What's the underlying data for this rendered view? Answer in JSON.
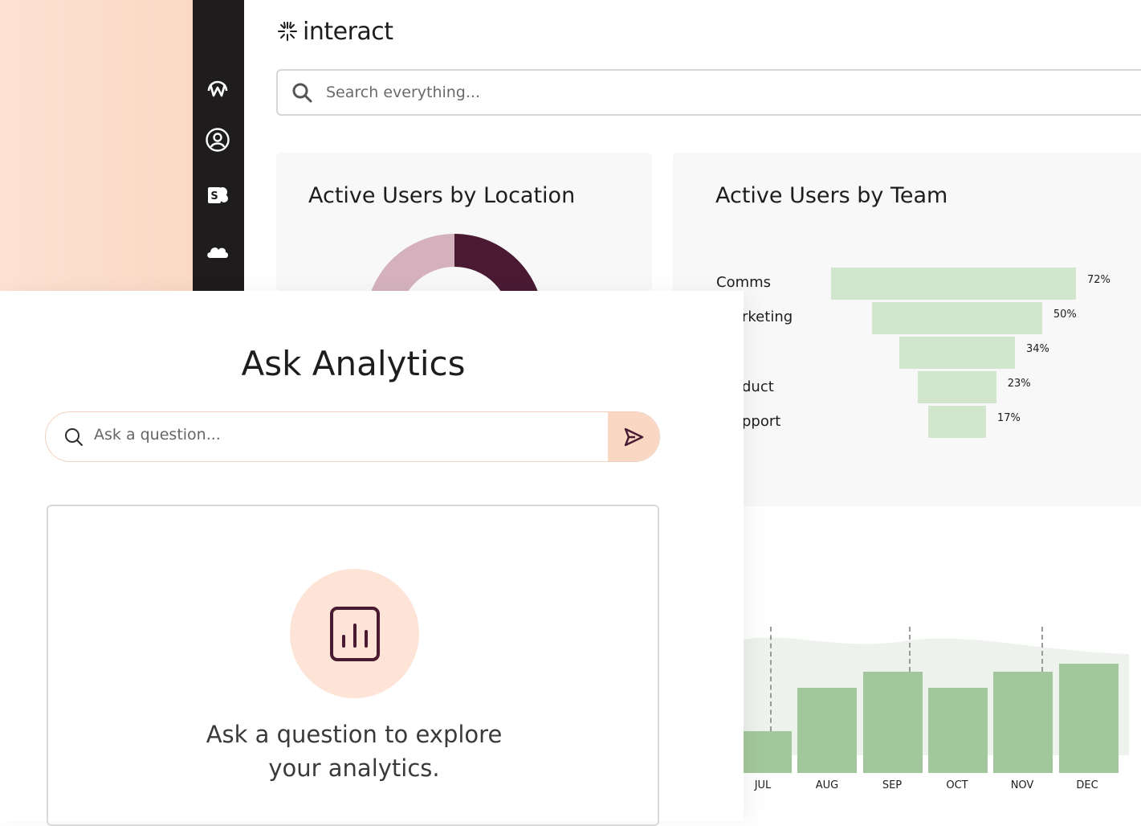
{
  "app": {
    "logo_text": "interact"
  },
  "search": {
    "placeholder": "Search everything..."
  },
  "nav": [
    {
      "icon": "workplace-icon"
    },
    {
      "icon": "user-circle-icon"
    },
    {
      "icon": "sharepoint-icon"
    },
    {
      "icon": "cloud-icon"
    }
  ],
  "location_card": {
    "title": "Active Users by Location"
  },
  "team_card": {
    "title": "Active Users by Team",
    "bars": [
      {
        "label": "Comms",
        "pct": "72%"
      },
      {
        "label": "rketing",
        "pct": "50%"
      },
      {
        "label": "",
        "pct": "34%"
      },
      {
        "label": "duct",
        "pct": "23%"
      },
      {
        "label": "pport",
        "pct": "17%"
      }
    ]
  },
  "chart_data": [
    {
      "type": "pie",
      "title": "Active Users by Location",
      "values": [
        50,
        50
      ],
      "colors": [
        "#4a1a33",
        "#d4b1bd"
      ]
    },
    {
      "type": "bar",
      "title": "Active Users by Team",
      "categories": [
        "Comms",
        "rketing",
        "",
        "duct",
        "pport"
      ],
      "values": [
        72,
        50,
        34,
        23,
        17
      ],
      "color": "#d2e6cd"
    },
    {
      "type": "bar",
      "categories": [
        "JUL",
        "AUG",
        "SEP",
        "OCT",
        "NOV",
        "DEC"
      ],
      "values": [
        52,
        106,
        126,
        106,
        126,
        136
      ],
      "color": "#a3c79c"
    }
  ],
  "ask_panel": {
    "title": "Ask Analytics",
    "input_placeholder": "Ask a question...",
    "empty_line1": "Ask a question to explore",
    "empty_line2": "your analytics."
  },
  "colors": {
    "accent": "#f9d7c3",
    "rail": "#1e1c1d",
    "plum": "#4a1a33",
    "green": "#a3c79c"
  }
}
